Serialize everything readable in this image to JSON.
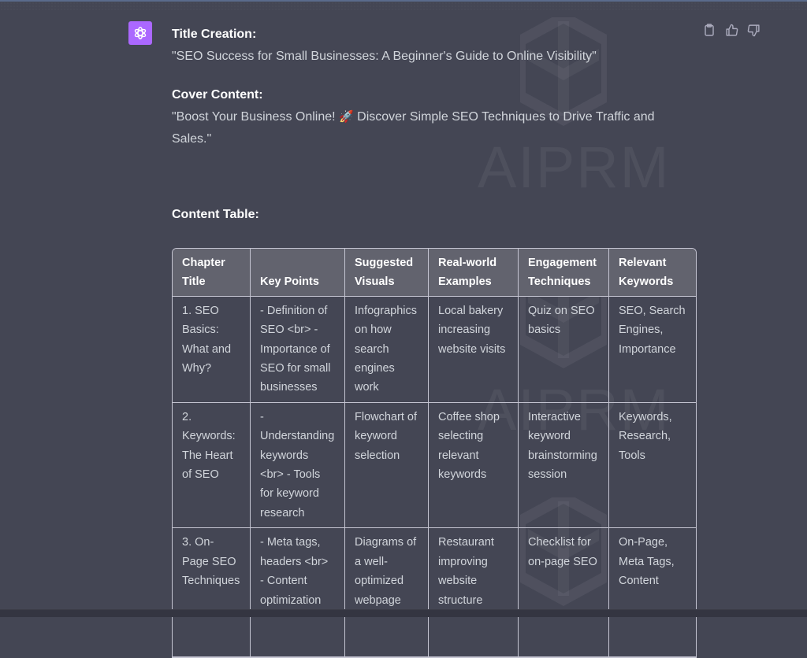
{
  "message": {
    "avatar_icon": "openai-logo-icon",
    "sections": [
      {
        "label": "Title Creation:",
        "text": "\"SEO Success for Small Businesses: A Beginner's Guide to Online Visibility\""
      },
      {
        "label": "Cover Content:",
        "text_before": "\"Boost Your Business Online! ",
        "emoji": "🚀",
        "text_after": " Discover Simple SEO Techniques to Drive Traffic and Sales.\""
      }
    ],
    "table_label": "Content Table:",
    "actions": [
      {
        "name": "copy",
        "icon": "clipboard-icon"
      },
      {
        "name": "thumbs-up",
        "icon": "thumbs-up-icon"
      },
      {
        "name": "thumbs-down",
        "icon": "thumbs-down-icon"
      }
    ]
  },
  "watermark": {
    "text": "AIPRM"
  },
  "table": {
    "headers": [
      "Chapter Title",
      "Key Points",
      "Suggested Visuals",
      "Real-world Examples",
      "Engagement Techniques",
      "Relevant Keywords"
    ],
    "rows": [
      [
        "1. SEO Basics: What and Why?",
        "- Definition of SEO <br> - Importance of SEO for small businesses",
        "Infographics on how search engines work",
        "Local bakery increasing website visits",
        "Quiz on SEO basics",
        "SEO, Search Engines, Importance"
      ],
      [
        "2. Keywords: The Heart of SEO",
        "- Understanding keywords <br> - Tools for keyword research",
        "Flowchart of keyword selection",
        "Coffee shop selecting relevant keywords",
        "Interactive keyword brainstorming session",
        "Keywords, Research, Tools"
      ],
      [
        "3. On-Page SEO Techniques",
        "- Meta tags, headers <br> - Content optimization",
        "Diagrams of a well-optimized webpage",
        "Restaurant improving website structure",
        "Checklist for on-page SEO",
        "On-Page, Meta Tags, Content"
      ],
      [
        "",
        "",
        "",
        "",
        "",
        ""
      ]
    ]
  }
}
